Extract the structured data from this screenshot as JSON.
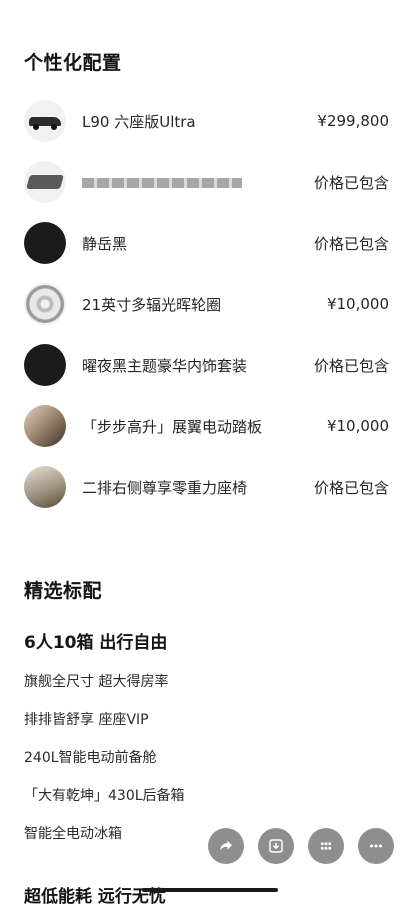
{
  "personalization": {
    "title": "个性化配置",
    "items": [
      {
        "label": "L90 六座版Ultra",
        "price": "¥299,800",
        "thumb": "car"
      },
      {
        "label": "",
        "price": "价格已包含",
        "thumb": "seat"
      },
      {
        "label": "静岳黑",
        "price": "价格已包含",
        "thumb": "black"
      },
      {
        "label": "21英寸多辐光晖轮圈",
        "price": "¥10,000",
        "thumb": "wheel"
      },
      {
        "label": "曜夜黑主题豪华内饰套装",
        "price": "价格已包含",
        "thumb": "black"
      },
      {
        "label": "「步步高升」展翼电动踏板",
        "price": "¥10,000",
        "thumb": "photo-a"
      },
      {
        "label": "二排右侧尊享零重力座椅",
        "price": "价格已包含",
        "thumb": "photo-b"
      }
    ]
  },
  "features": {
    "title": "精选标配",
    "headline": "6人10箱 出行自由",
    "items": [
      "旗舰全尺寸 超大得房率",
      "排排皆舒享 座座VIP",
      "240L智能电动前备舱",
      "「大有乾坤」430L后备箱",
      "智能全电动冰箱"
    ],
    "next_headline": "超低能耗 远行无忧"
  },
  "actions": [
    {
      "name": "share-icon"
    },
    {
      "name": "download-icon"
    },
    {
      "name": "grid-icon"
    },
    {
      "name": "more-icon"
    }
  ]
}
